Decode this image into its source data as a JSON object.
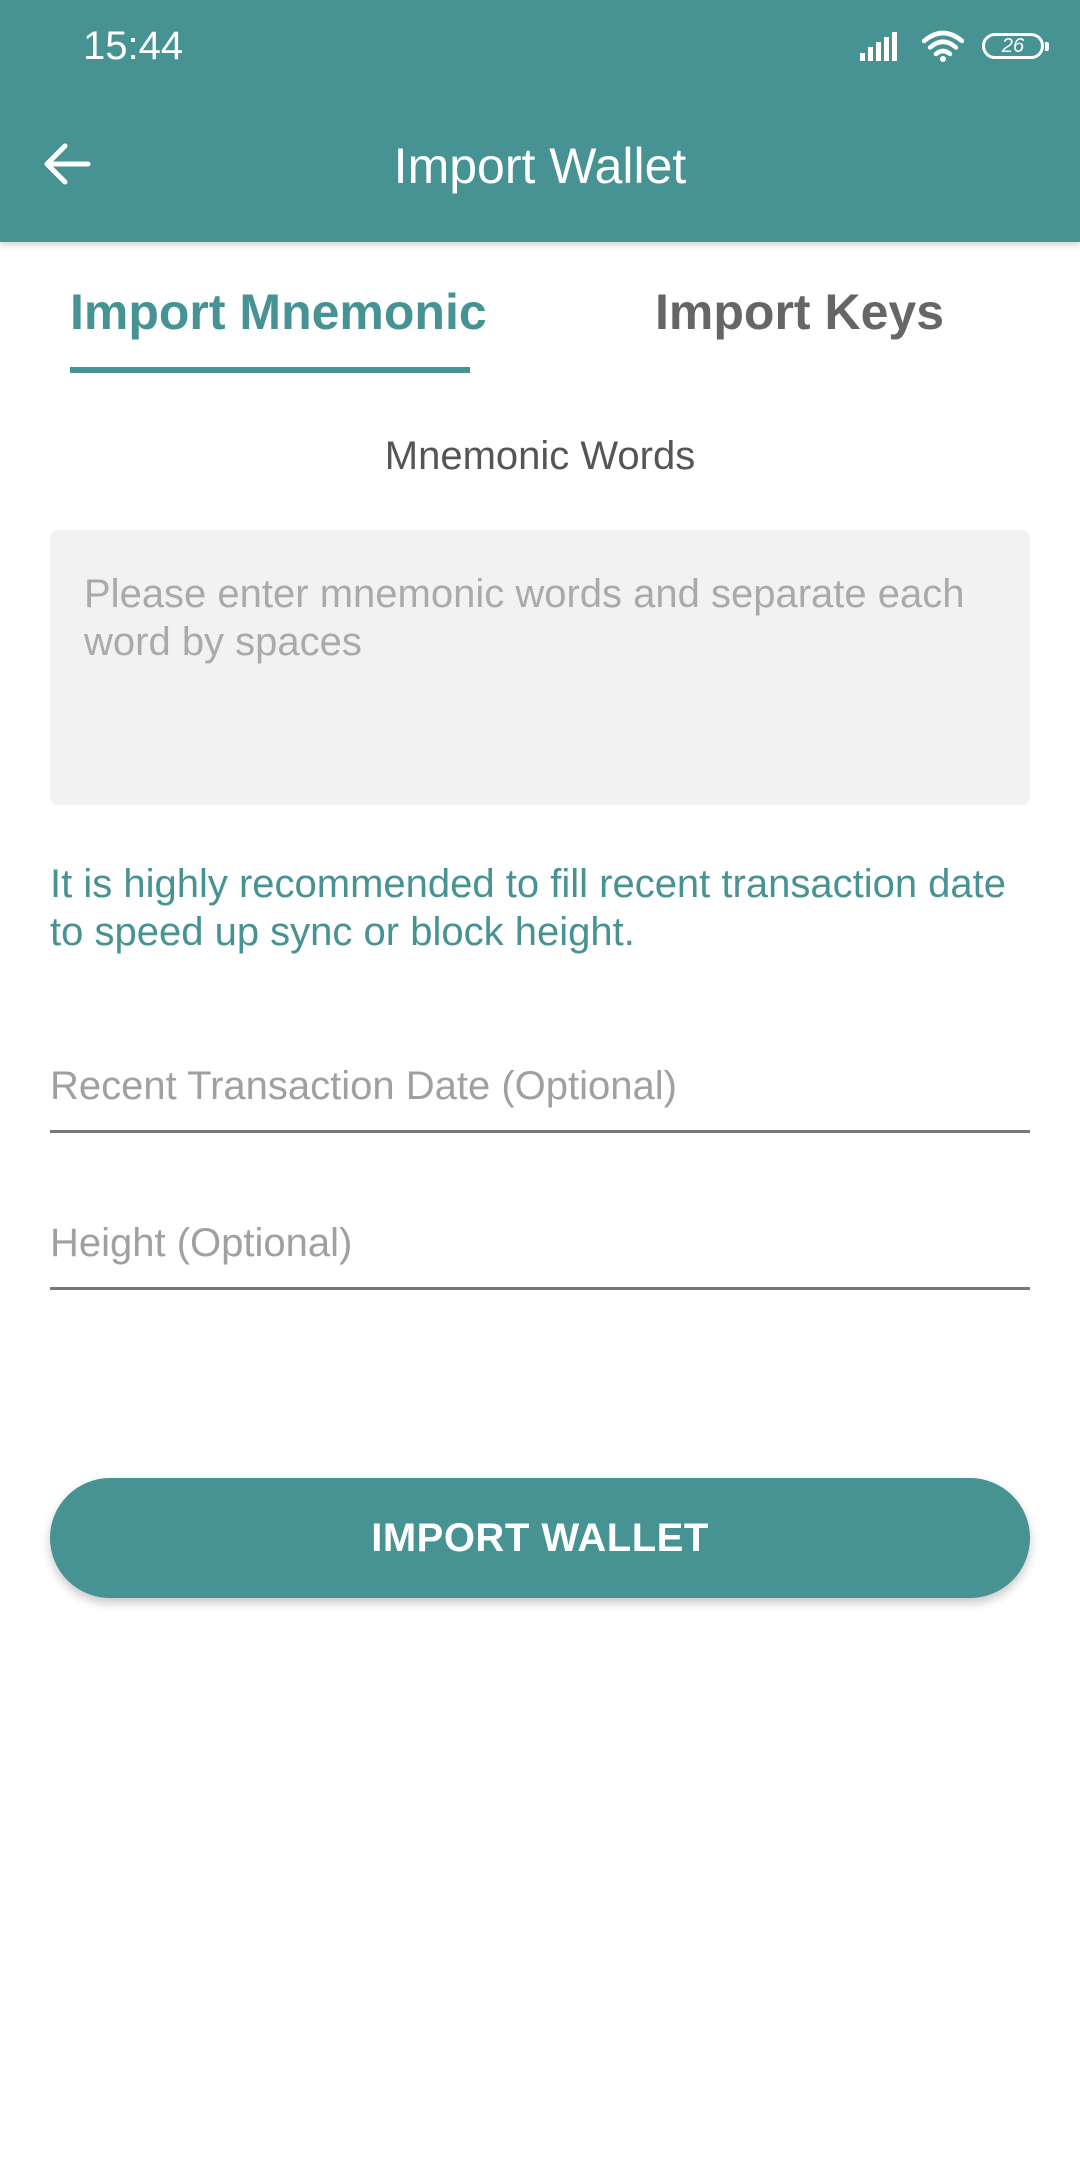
{
  "status_bar": {
    "time": "15:44",
    "battery_level": "26",
    "icons": [
      "signal-icon",
      "wifi-icon",
      "battery-icon"
    ]
  },
  "header": {
    "title": "Import Wallet",
    "back_icon": "arrow-left-icon",
    "background_color": "#479292"
  },
  "tabs": [
    {
      "label": "Import Mnemonic",
      "active": true
    },
    {
      "label": "Import Keys",
      "active": false
    }
  ],
  "mnemonic": {
    "section_label": "Mnemonic Words",
    "placeholder": "Please enter mnemonic words and separate each word by spaces"
  },
  "hint": "It is highly recommended to fill recent transaction date to speed up sync or block height.",
  "fields": {
    "date_placeholder": "Recent Transaction Date (Optional)",
    "height_placeholder": "Height (Optional)"
  },
  "import_button_label": "IMPORT WALLET",
  "colors": {
    "accent": "#479292",
    "inactive_tab": "#666666",
    "placeholder": "#a0a0a0"
  }
}
